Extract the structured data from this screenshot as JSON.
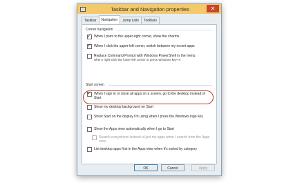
{
  "window": {
    "title": "Taskbar and Navigation properties",
    "close_glyph": "✕"
  },
  "tabs": [
    {
      "label": "Taskbar",
      "active": false
    },
    {
      "label": "Navigation",
      "active": true
    },
    {
      "label": "Jump Lists",
      "active": false
    },
    {
      "label": "Toolbars",
      "active": false
    }
  ],
  "corner_navigation": {
    "title": "Corner navigation",
    "options": [
      {
        "label": "When I point to the upper-right corner, show the charms",
        "checked": true
      },
      {
        "label": "When I click the upper-left corner, switch between my recent apps",
        "checked": true
      },
      {
        "label": "Replace Command Prompt with Windows PowerShell in the menu",
        "sub": "when I right-click the lower-left corner or press Windows key+X",
        "checked": false
      }
    ]
  },
  "start_screen": {
    "title": "Start screen",
    "options": [
      {
        "label": "When I sign in or close all apps on a screen, go to the desktop instead of Start",
        "checked": true
      },
      {
        "label": "Show my desktop background on Start",
        "checked": false
      },
      {
        "label": "Show Start on the display I'm using when I press the Windows logo key",
        "checked": false
      },
      {
        "label": "Show the Apps view automatically when I go to Start",
        "checked": false
      },
      {
        "label": "Search everywhere instead of just my apps when I search from the Apps view",
        "checked": false,
        "disabled": true
      },
      {
        "label": "List desktop apps first in the Apps view when it's sorted by category",
        "checked": false
      }
    ]
  },
  "buttons": {
    "ok": "OK",
    "cancel": "Cancel",
    "apply": "Apply"
  },
  "colors": {
    "titlebar": "#f4c96b",
    "close": "#c7462e",
    "highlight": "#c0392b"
  }
}
